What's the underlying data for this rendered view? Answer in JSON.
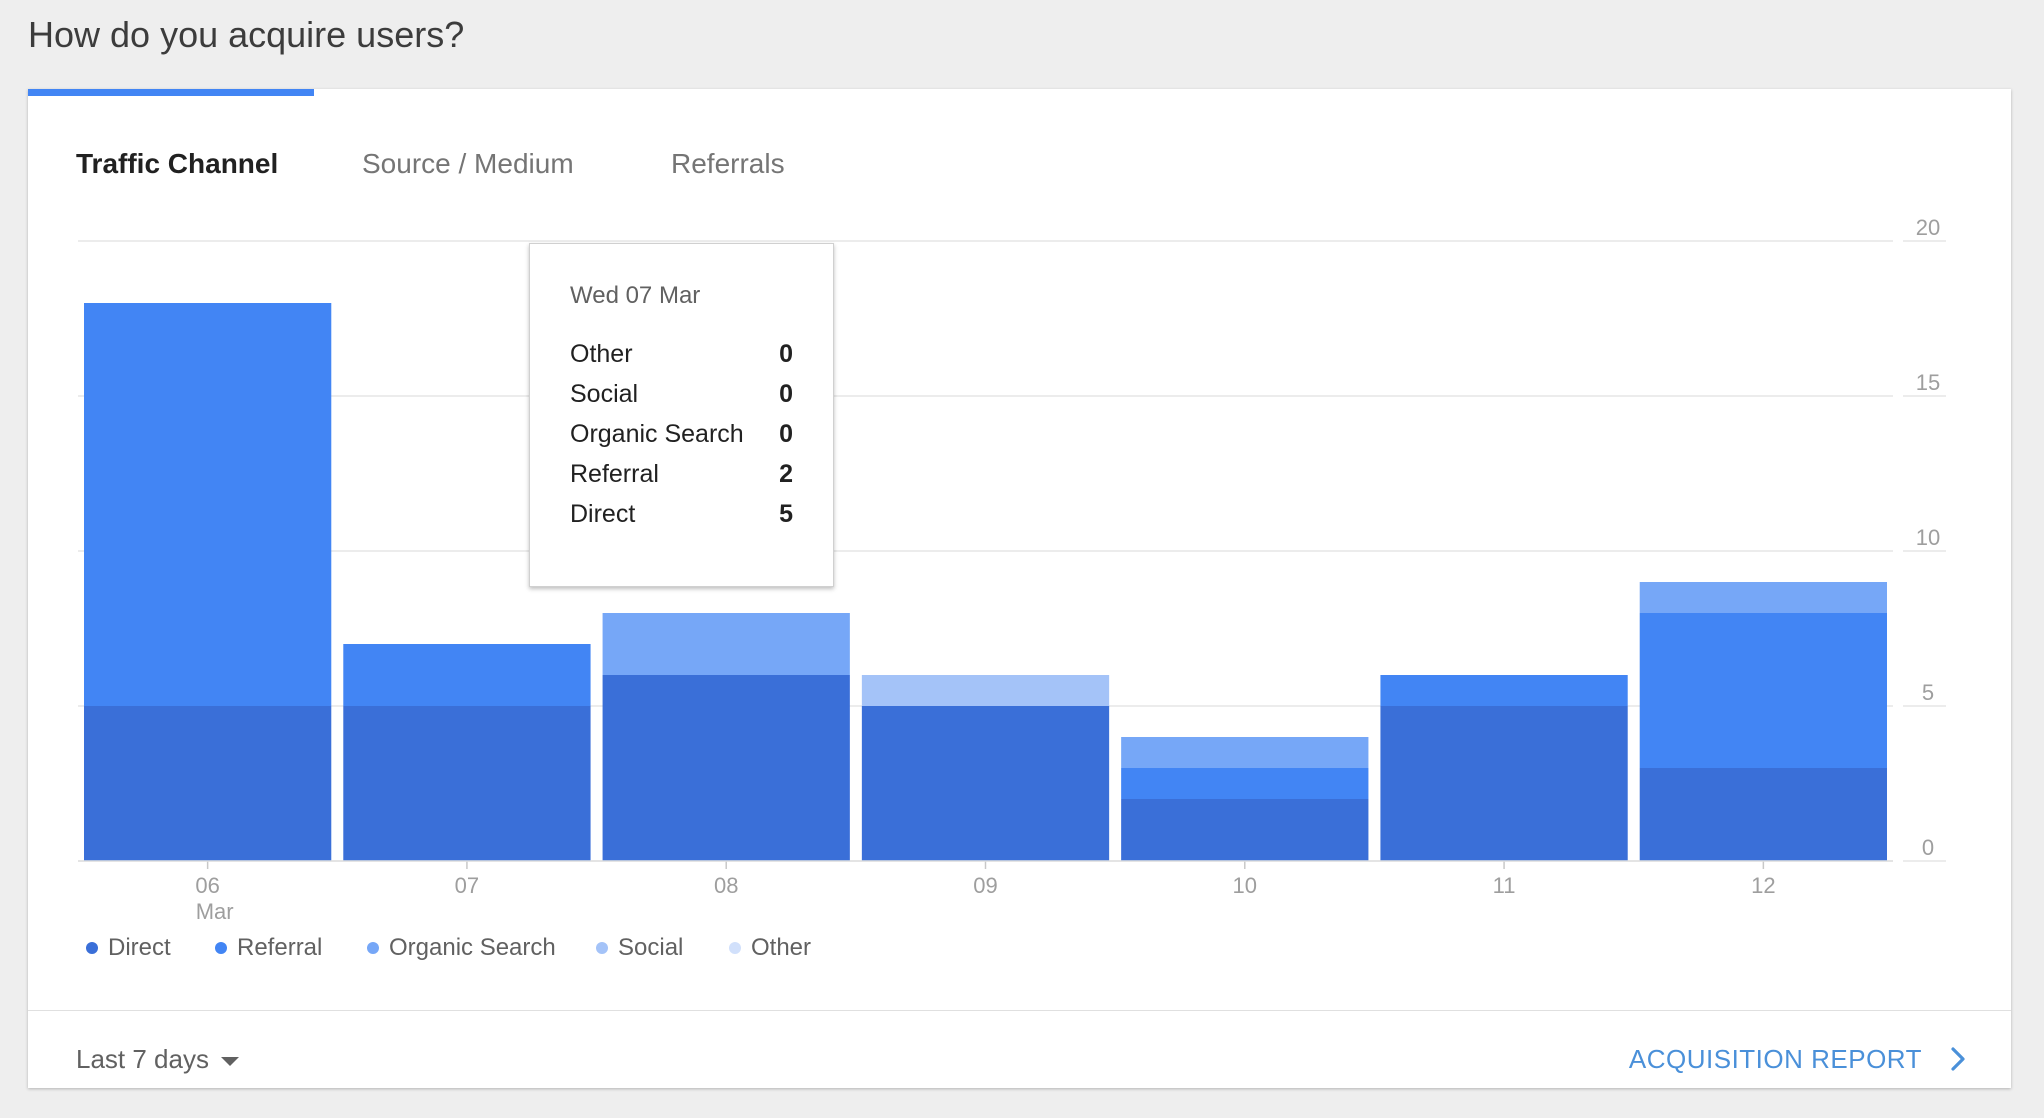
{
  "page_title": "How do you acquire users?",
  "tabs": [
    {
      "label": "Traffic Channel",
      "active": true
    },
    {
      "label": "Source / Medium",
      "active": false
    },
    {
      "label": "Referrals",
      "active": false
    }
  ],
  "chart_data": {
    "type": "bar",
    "stacked": true,
    "categories": [
      "06",
      "07",
      "08",
      "09",
      "10",
      "11",
      "12"
    ],
    "category_sublabels": [
      "Mar",
      "",
      "",
      "",
      "",
      "",
      ""
    ],
    "series": [
      {
        "name": "Direct",
        "color": "#3a6fd8",
        "values": [
          5,
          5,
          6,
          5,
          2,
          5,
          3
        ]
      },
      {
        "name": "Referral",
        "color": "#4285f4",
        "values": [
          13,
          2,
          0,
          0,
          1,
          1,
          5
        ]
      },
      {
        "name": "Organic Search",
        "color": "#76a7f7",
        "values": [
          0,
          0,
          2,
          0,
          1,
          0,
          1
        ]
      },
      {
        "name": "Social",
        "color": "#a4c3f8",
        "values": [
          0,
          0,
          0,
          1,
          0,
          0,
          0
        ]
      },
      {
        "name": "Other",
        "color": "#d1e0fb",
        "values": [
          0,
          0,
          0,
          0,
          0,
          0,
          0
        ]
      }
    ],
    "ylim": [
      0,
      20
    ],
    "y_ticks": [
      "0",
      "5",
      "10",
      "15",
      "20"
    ],
    "y_axis_side": "right",
    "grid": true,
    "legend_position": "bottom-left"
  },
  "tooltip": {
    "date": "Wed 07 Mar",
    "rows": [
      {
        "label": "Other",
        "value": "0"
      },
      {
        "label": "Social",
        "value": "0"
      },
      {
        "label": "Organic Search",
        "value": "0"
      },
      {
        "label": "Referral",
        "value": "2"
      },
      {
        "label": "Direct",
        "value": "5"
      }
    ]
  },
  "footer": {
    "date_range": "Last 7 days",
    "report_link": "ACQUISITION REPORT"
  }
}
